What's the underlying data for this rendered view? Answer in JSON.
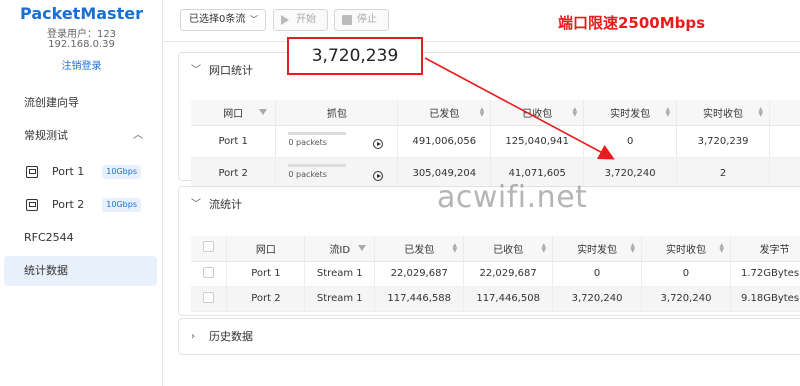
{
  "app": {
    "title": "PacketMaster",
    "login_user": "登录用户：123",
    "ip": "192.168.0.39",
    "logout": "注销登录"
  },
  "sidebar": {
    "items": [
      {
        "label": "流创建向导"
      },
      {
        "label": "常规测试"
      },
      {
        "label": "RFC2544"
      },
      {
        "label": "统计数据"
      }
    ],
    "ports": [
      {
        "label": "Port 1",
        "speed": "10Gbps"
      },
      {
        "label": "Port 2",
        "speed": "10Gbps"
      }
    ]
  },
  "toolbar": {
    "select_label": "已选择0条流",
    "start_label": "开始",
    "stop_label": "停止"
  },
  "annotation": {
    "throttle_text": "端口限速2500Mbps",
    "callout_value": "3,720,239",
    "watermark": "acwifi.net",
    "accent_color": "#e81c1c"
  },
  "port_stats": {
    "section_title": "网口统计",
    "columns": [
      "网口",
      "抓包",
      "已发包",
      "已收包",
      "实时发包",
      "实时收包"
    ],
    "rows": [
      {
        "port": "Port 1",
        "capture": "0 packets",
        "sent": "491,006,056",
        "received": "125,040,941",
        "rt_sent": "0",
        "rt_recv": "3,720,239"
      },
      {
        "port": "Port 2",
        "capture": "0 packets",
        "sent": "305,049,204",
        "received": "41,071,605",
        "rt_sent": "3,720,240",
        "rt_recv": "2"
      }
    ]
  },
  "flow_stats": {
    "section_title": "流统计",
    "columns": [
      "网口",
      "流ID",
      "已发包",
      "已收包",
      "实时发包",
      "实时收包",
      "发字节"
    ],
    "rows": [
      {
        "port": "Port 1",
        "flow": "Stream 1",
        "sent": "22,029,687",
        "received": "22,029,687",
        "rt_sent": "0",
        "rt_recv": "0",
        "bytes": "1.72GBytes"
      },
      {
        "port": "Port 2",
        "flow": "Stream 1",
        "sent": "117,446,588",
        "received": "117,446,508",
        "rt_sent": "3,720,240",
        "rt_recv": "3,720,240",
        "bytes": "9.18GBytes"
      }
    ]
  },
  "history": {
    "section_title": "历史数据"
  }
}
